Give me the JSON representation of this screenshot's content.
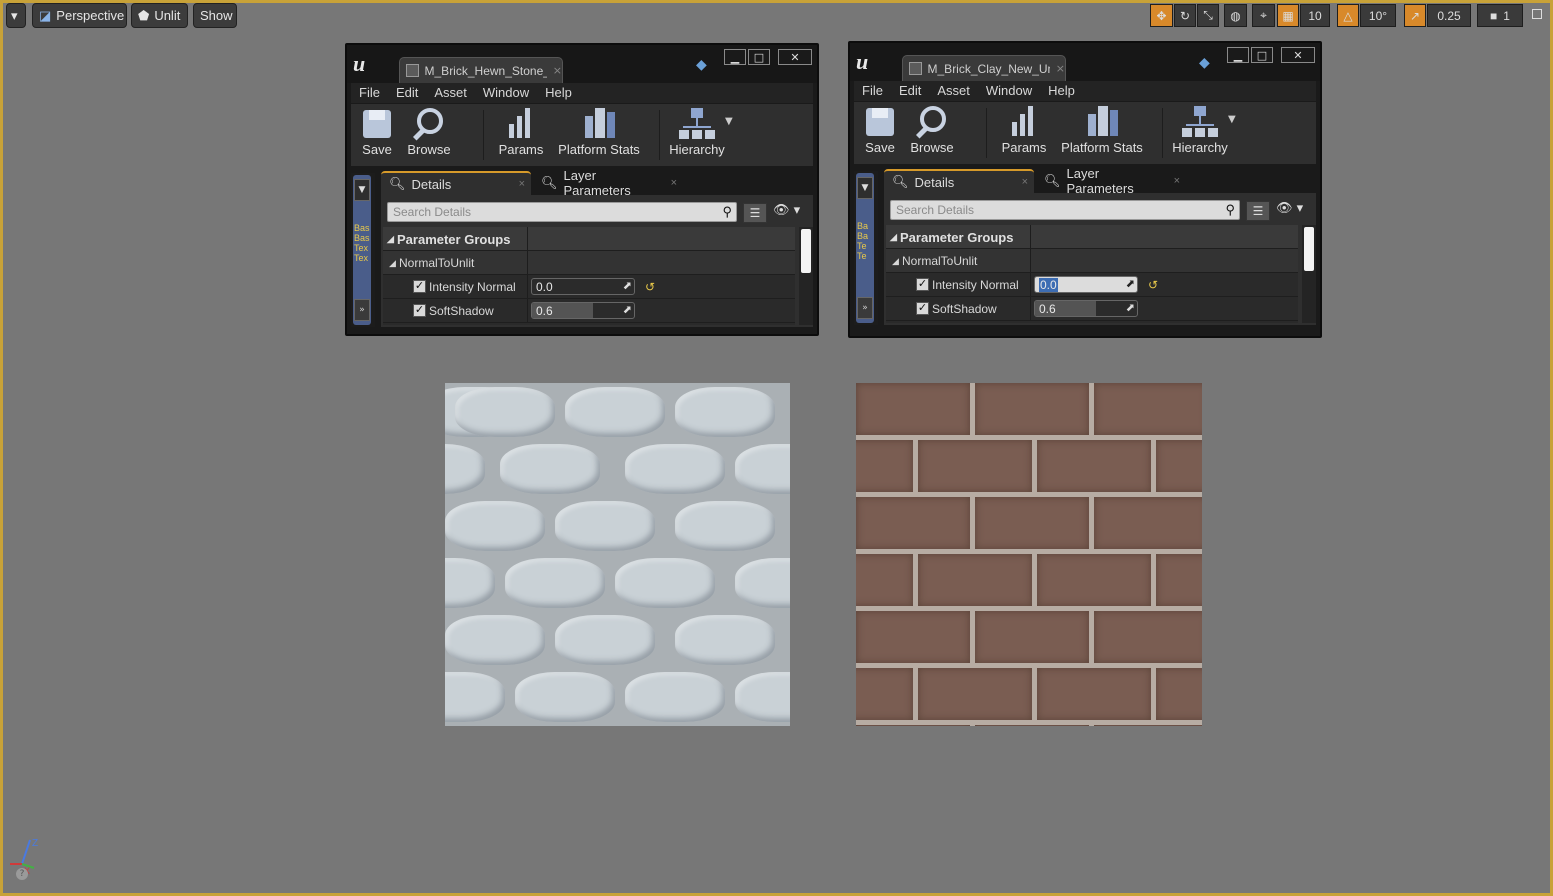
{
  "viewport_toolbar": {
    "perspective_label": "Perspective",
    "lit_label": "Unlit",
    "show_label": "Show",
    "grid_size": "10",
    "rotation_snap": "10°",
    "scale_snap": "0.25",
    "camera_speed": "1"
  },
  "windows": [
    {
      "tab_title": "M_Brick_Hewn_Stone_Un",
      "menu": [
        "File",
        "Edit",
        "Asset",
        "Window",
        "Help"
      ],
      "toolbar": {
        "save": "Save",
        "browse": "Browse",
        "params": "Params",
        "platform_stats": "Platform Stats",
        "hierarchy": "Hierarchy"
      },
      "side_text": [
        "Bas",
        "Bas",
        "Tex",
        "Tex"
      ],
      "tabs": {
        "details": "Details",
        "layer_parameters": "Layer Parameters"
      },
      "search_placeholder": "Search Details",
      "parameter_groups_label": "Parameter Groups",
      "group_name": "NormalToUnlit",
      "params": [
        {
          "label": "Intensity Normal",
          "value": "0.0",
          "fill": 0.0
        },
        {
          "label": "SoftShadow",
          "value": "0.6",
          "fill": 0.6
        }
      ]
    },
    {
      "tab_title": "M_Brick_Clay_New_Unlit",
      "menu": [
        "File",
        "Edit",
        "Asset",
        "Window",
        "Help"
      ],
      "toolbar": {
        "save": "Save",
        "browse": "Browse",
        "params": "Params",
        "platform_stats": "Platform Stats",
        "hierarchy": "Hierarchy"
      },
      "side_text": [
        "Ba",
        "Ba",
        "Te",
        "Te"
      ],
      "tabs": {
        "details": "Details",
        "layer_parameters": "Layer Parameters"
      },
      "search_placeholder": "Search Details",
      "parameter_groups_label": "Parameter Groups",
      "group_name": "NormalToUnlit",
      "params": [
        {
          "label": "Intensity Normal",
          "value": "0.0",
          "fill": 0.0
        },
        {
          "label": "SoftShadow",
          "value": "0.6",
          "fill": 0.6
        }
      ]
    }
  ],
  "axis": {
    "z": "Z",
    "x": "X"
  },
  "colors": {
    "accent": "#d69a2a",
    "frame": "#c8a238",
    "viewport_bg": "#777777"
  }
}
